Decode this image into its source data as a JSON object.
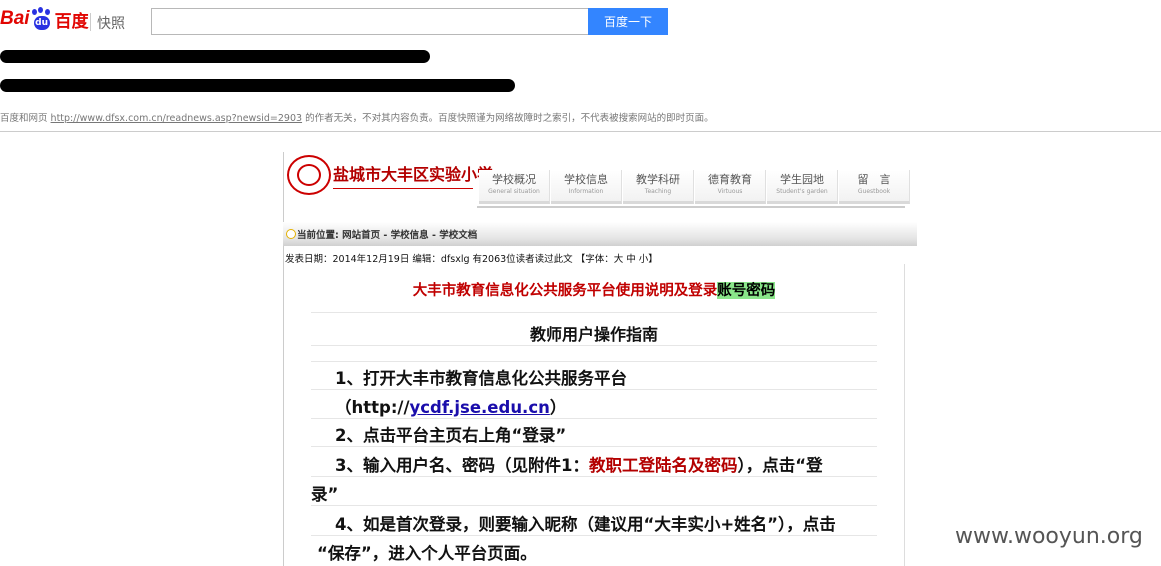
{
  "baidu": {
    "logo_bai": "Bai",
    "logo_du": "du",
    "logo_cn": "百度",
    "snapshot_label": "快照",
    "search_value": "",
    "search_button": "百度一下"
  },
  "notices": {
    "disclaimer_prefix": "百度和网页",
    "disclaimer_url": "http://www.dfsx.com.cn/readnews.asp?newsid=2903",
    "disclaimer_suffix": "的作者无关，不对其内容负责。百度快照谨为网络故障时之索引，不代表被搜索网站的即时页面。"
  },
  "school": {
    "name": "盐城市大丰区实验小学",
    "nav": [
      {
        "zh": "学校概况",
        "en": "General situation"
      },
      {
        "zh": "学校信息",
        "en": "Information"
      },
      {
        "zh": "教学科研",
        "en": "Teaching"
      },
      {
        "zh": "德育教育",
        "en": "Virtuous"
      },
      {
        "zh": "学生园地",
        "en": "Student's garden"
      },
      {
        "zh": "留　言",
        "en": "Guestbook"
      }
    ],
    "breadcrumb": "当前位置: 网站首页 - 学校信息 - 学校文档",
    "pub_info": "发表日期：2014年12月19日  编辑：dfsxlg 有2063位读者读过此文 【字体：大 中 小】"
  },
  "article": {
    "title_main": "大丰市教育信息化公共服务平台使用说明及登录",
    "title_highlight": "账号密码",
    "guide_title": "教师用户操作指南",
    "step1": "1、打开大丰市教育信息化公共服务平台",
    "step1_paren_open": "（http://",
    "step1_link": "ycdf.jse.edu.cn",
    "step1_paren_close": "）",
    "step2": "2、点击平台主页右上角“登录”",
    "step3_a": "3、输入用户名、密码（见附件1：",
    "step3_red": "教职工登陆名及密码",
    "step3_b": "），点击“登",
    "step3_c": "录”",
    "step4_a": "4、如是首次登录，则要输入昵称（建议用“大丰实小+姓名”），点击",
    "step4_b": "“保存”，进入个人平台页面。"
  },
  "watermark": "www.wooyun.org"
}
